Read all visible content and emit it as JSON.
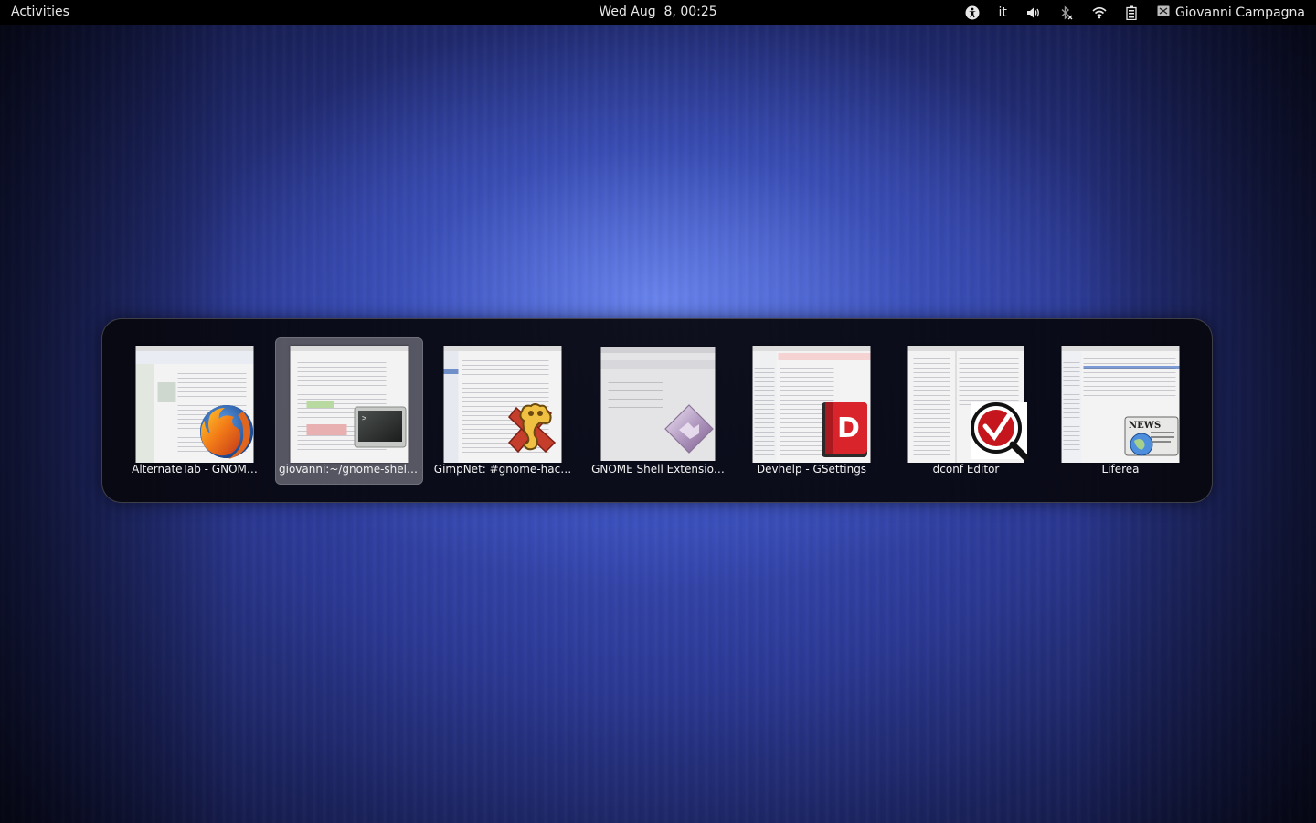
{
  "topbar": {
    "activities": "Activities",
    "clock": "Wed Aug  8, 00:25",
    "keyboard_layout": "it",
    "user_name": "Giovanni Campagna",
    "icons": [
      "accessibility-icon",
      "volume-icon",
      "bluetooth-icon",
      "wifi-icon",
      "battery-icon",
      "user-status-icon"
    ]
  },
  "switcher": {
    "selected_index": 1,
    "windows": [
      {
        "label": "AlternateTab - GNOM…",
        "icon": "firefox-icon"
      },
      {
        "label": "giovanni:~/gnome-shell…",
        "icon": "terminal-icon"
      },
      {
        "label": "GimpNet: #gnome-hac…",
        "icon": "xchat-icon"
      },
      {
        "label": "GNOME Shell Extensio…",
        "icon": "extension-icon"
      },
      {
        "label": "Devhelp - GSettings",
        "icon": "devhelp-icon"
      },
      {
        "label": "dconf Editor",
        "icon": "dconf-icon"
      },
      {
        "label": "Liferea",
        "icon": "liferea-icon"
      }
    ]
  },
  "colors": {
    "panel": "#000000",
    "background_center": "#6f8bf0",
    "background_edge": "#0a0d28",
    "switcher_bg": "#08080e",
    "selection": "#8c8c96"
  }
}
